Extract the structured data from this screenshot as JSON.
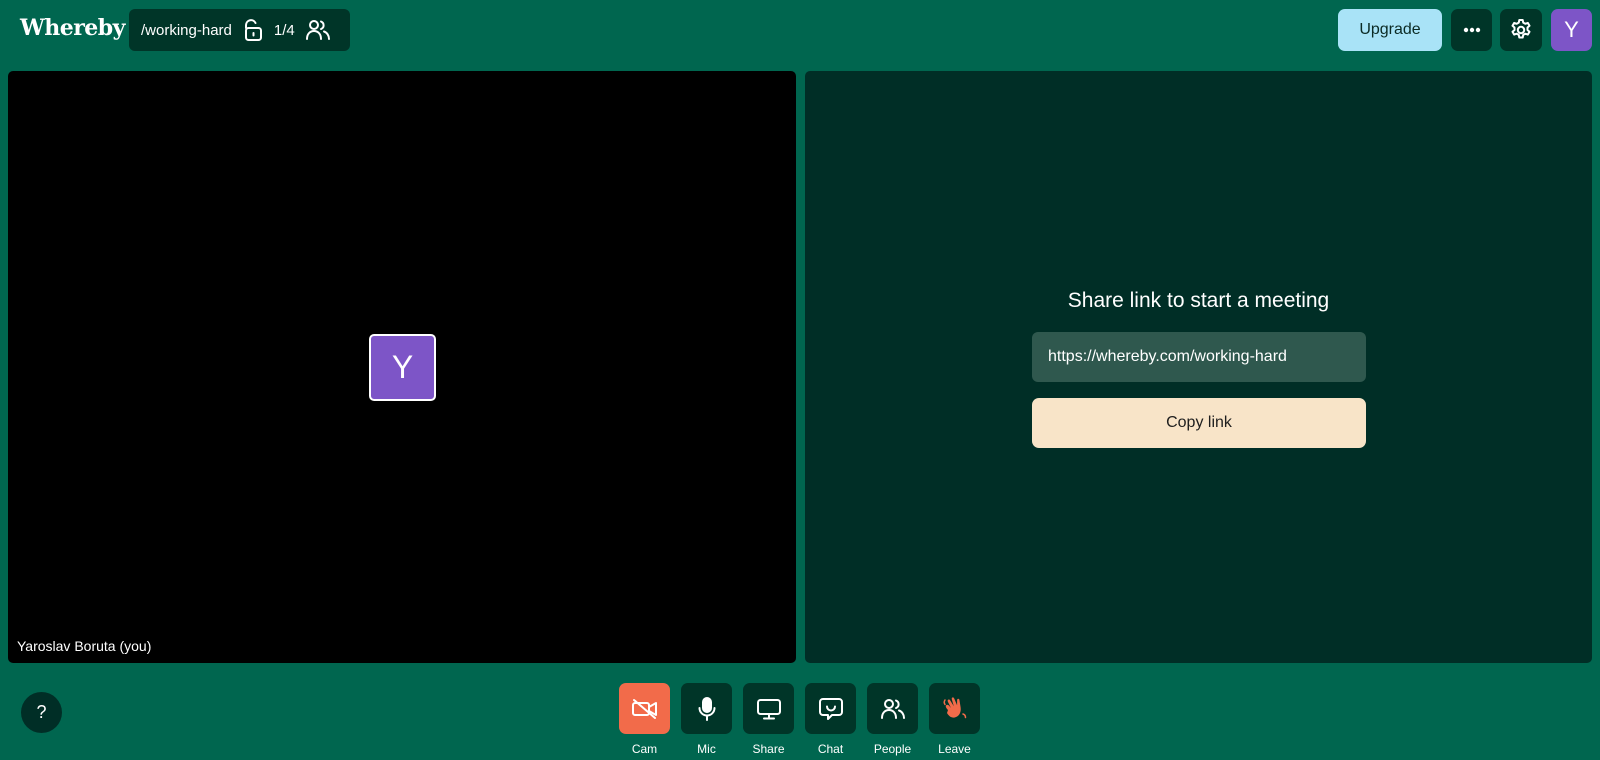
{
  "app": {
    "logo_text": "Whereby"
  },
  "room": {
    "name": "/working-hard",
    "participant_count": "1/4",
    "lock_icon": "unlocked-padlock-icon",
    "people_icon": "people-icon"
  },
  "header": {
    "upgrade_label": "Upgrade",
    "more_icon": "more-dots-icon",
    "settings_icon": "gear-icon",
    "avatar_initial": "Y"
  },
  "self_tile": {
    "avatar_initial": "Y",
    "name_label": "Yaroslav Boruta (you)"
  },
  "share_panel": {
    "title": "Share link to start a meeting",
    "link_value": "https://whereby.com/working-hard",
    "copy_label": "Copy link"
  },
  "help": {
    "label": "?"
  },
  "toolbar": {
    "items": [
      {
        "label": "Cam",
        "icon": "camera-off-icon",
        "active": true
      },
      {
        "label": "Mic",
        "icon": "microphone-icon",
        "active": false
      },
      {
        "label": "Share",
        "icon": "screen-share-icon",
        "active": false
      },
      {
        "label": "Chat",
        "icon": "chat-icon",
        "active": false
      },
      {
        "label": "People",
        "icon": "people-icon",
        "active": false
      },
      {
        "label": "Leave",
        "icon": "waving-hand-icon",
        "active": false
      }
    ]
  },
  "colors": {
    "background": "#00664f",
    "panel_dark": "#002e26",
    "avatar_purple": "#7d55c7",
    "upgrade_blue": "#a9e3f7",
    "cam_active": "#f26b4a",
    "copy_button": "#f8e4c8",
    "leave_hand": "#f26b4a"
  }
}
